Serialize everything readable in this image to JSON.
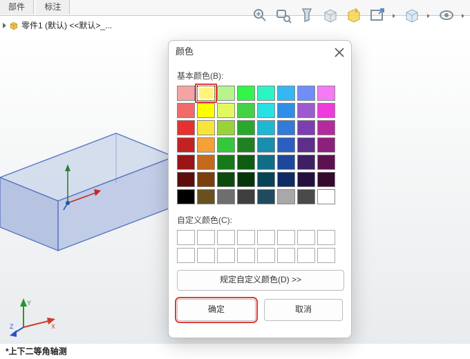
{
  "tabs": {
    "t0": "部件",
    "t1": "标注"
  },
  "tree_label": "零件1 (默认) <<默认>_...",
  "status_text": "*上下二等角轴测",
  "dialog": {
    "title": "颜色",
    "basic_label": "基本颜色(B):",
    "custom_label": "自定义颜色(C):",
    "define_btn": "规定自定义颜色(D) >>",
    "ok": "确定",
    "cancel": "取消",
    "selected_index": 1,
    "basic_colors": [
      "#f6a3a3",
      "#fff57a",
      "#b8f48d",
      "#34f44a",
      "#2ef4c4",
      "#35b7f6",
      "#6f8ef9",
      "#f57af5",
      "#f26a6a",
      "#ffff00",
      "#e2f861",
      "#42d245",
      "#29e0e4",
      "#2f8ee5",
      "#9d5bcf",
      "#f03bdc",
      "#e63131",
      "#f9e53a",
      "#9ad23a",
      "#2aa82d",
      "#1fb7d6",
      "#327bd7",
      "#7b3fb1",
      "#b62aa0",
      "#c32222",
      "#f6a038",
      "#35c83b",
      "#1f8222",
      "#188fae",
      "#2c5fc0",
      "#5d2f8c",
      "#8c207b",
      "#991515",
      "#c56a1c",
      "#167a19",
      "#0e5c11",
      "#0f6d88",
      "#1d479b",
      "#3d1f63",
      "#5b124f",
      "#5e0c0c",
      "#7d3e0e",
      "#0c4a0e",
      "#06370a",
      "#084457",
      "#0e2b66",
      "#240f3e",
      "#350a2d",
      "#000000",
      "#6a4f1f",
      "#6e6e6e",
      "#3f3f3f",
      "#214a5e",
      "#a8a8a8",
      "#4a4a4a",
      "#ffffff"
    ]
  },
  "icons": {
    "part": "part-icon",
    "zoom_fit": "zoom-fit-icon",
    "zoom_area": "zoom-area-icon",
    "flashlight": "flashlight-icon",
    "section": "section-cube-icon",
    "appearance": "appearance-icon",
    "new_view": "new-view-icon",
    "box_view": "box-view-icon",
    "visibility": "visibility-eye-icon"
  }
}
